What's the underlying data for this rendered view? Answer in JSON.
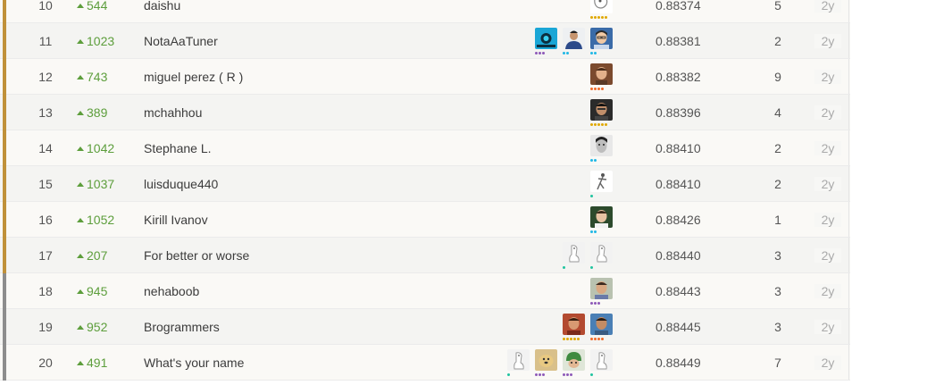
{
  "rows": [
    {
      "rank": "10",
      "delta": "544",
      "team": "daishu",
      "score": "0.88374",
      "entries": "5",
      "last": "2y",
      "medal": "gold",
      "members": [
        {
          "kind": "sketch",
          "dots": [
            "#e0a800",
            "#e0a800",
            "#e0a800",
            "#e0a800",
            "#e0a800"
          ]
        }
      ]
    },
    {
      "rank": "11",
      "delta": "1023",
      "team": "NotaAaTuner",
      "score": "0.88381",
      "entries": "2",
      "last": "2y",
      "medal": "gold",
      "members": [
        {
          "kind": "glasses-woman",
          "dots": [
            "#20b8e6",
            "#20b8e6"
          ]
        },
        {
          "kind": "man-shirt",
          "dots": [
            "#20b8e6",
            "#20b8e6"
          ]
        },
        {
          "kind": "cyan-logo",
          "dots": [
            "#8e5ab8",
            "#8e5ab8",
            "#8e5ab8"
          ]
        }
      ]
    },
    {
      "rank": "12",
      "delta": "743",
      "team": "miguel perez ( R )",
      "score": "0.88382",
      "entries": "9",
      "last": "2y",
      "medal": "gold",
      "members": [
        {
          "kind": "face-warm",
          "dots": [
            "#f06a2a",
            "#f06a2a",
            "#f06a2a",
            "#f06a2a"
          ]
        }
      ]
    },
    {
      "rank": "13",
      "delta": "389",
      "team": "mchahhou",
      "score": "0.88396",
      "entries": "4",
      "last": "2y",
      "medal": "gold",
      "members": [
        {
          "kind": "face-dark",
          "dots": [
            "#e0a800",
            "#e0a800",
            "#e0a800",
            "#e0a800",
            "#e0a800"
          ]
        }
      ]
    },
    {
      "rank": "14",
      "delta": "1042",
      "team": "Stephane L.",
      "score": "0.88410",
      "entries": "2",
      "last": "2y",
      "medal": "gold",
      "members": [
        {
          "kind": "face-bw",
          "dots": [
            "#20b8e6",
            "#20b8e6"
          ]
        }
      ]
    },
    {
      "rank": "15",
      "delta": "1037",
      "team": "luisduque440",
      "score": "0.88410",
      "entries": "2",
      "last": "2y",
      "medal": "gold",
      "members": [
        {
          "kind": "figure",
          "dots": [
            "#20c4a0"
          ]
        }
      ]
    },
    {
      "rank": "16",
      "delta": "1052",
      "team": "Kirill Ivanov",
      "score": "0.88426",
      "entries": "1",
      "last": "2y",
      "medal": "gold",
      "members": [
        {
          "kind": "face-green",
          "dots": [
            "#20b8e6",
            "#20b8e6"
          ]
        }
      ]
    },
    {
      "rank": "17",
      "delta": "207",
      "team": "For better or worse",
      "score": "0.88440",
      "entries": "3",
      "last": "2y",
      "medal": "gold",
      "members": [
        {
          "kind": "default",
          "dots": [
            "#20c4a0"
          ]
        },
        {
          "kind": "default",
          "dots": [
            "#20c4a0"
          ]
        }
      ]
    },
    {
      "rank": "18",
      "delta": "945",
      "team": "nehaboob",
      "score": "0.88443",
      "entries": "3",
      "last": "2y",
      "medal": "silver",
      "members": [
        {
          "kind": "face-light",
          "dots": [
            "#8e5ab8",
            "#8e5ab8",
            "#8e5ab8"
          ]
        }
      ]
    },
    {
      "rank": "19",
      "delta": "952",
      "team": "Brogrammers",
      "score": "0.88445",
      "entries": "3",
      "last": "2y",
      "medal": "silver",
      "members": [
        {
          "kind": "face-blue",
          "dots": [
            "#f06a2a",
            "#f06a2a",
            "#f06a2a",
            "#f06a2a"
          ]
        },
        {
          "kind": "face-red",
          "dots": [
            "#e0a800",
            "#e0a800",
            "#e0a800",
            "#e0a800",
            "#e0a800"
          ]
        }
      ]
    },
    {
      "rank": "20",
      "delta": "491",
      "team": "What's your name",
      "score": "0.88449",
      "entries": "7",
      "last": "2y",
      "medal": "silver",
      "members": [
        {
          "kind": "default",
          "dots": [
            "#20c4a0"
          ]
        },
        {
          "kind": "helmet",
          "dots": [
            "#8e5ab8",
            "#8e5ab8",
            "#8e5ab8"
          ]
        },
        {
          "kind": "doge",
          "dots": [
            "#8e5ab8",
            "#8e5ab8",
            "#8e5ab8"
          ]
        },
        {
          "kind": "default",
          "dots": [
            "#20c4a0"
          ]
        }
      ]
    }
  ]
}
